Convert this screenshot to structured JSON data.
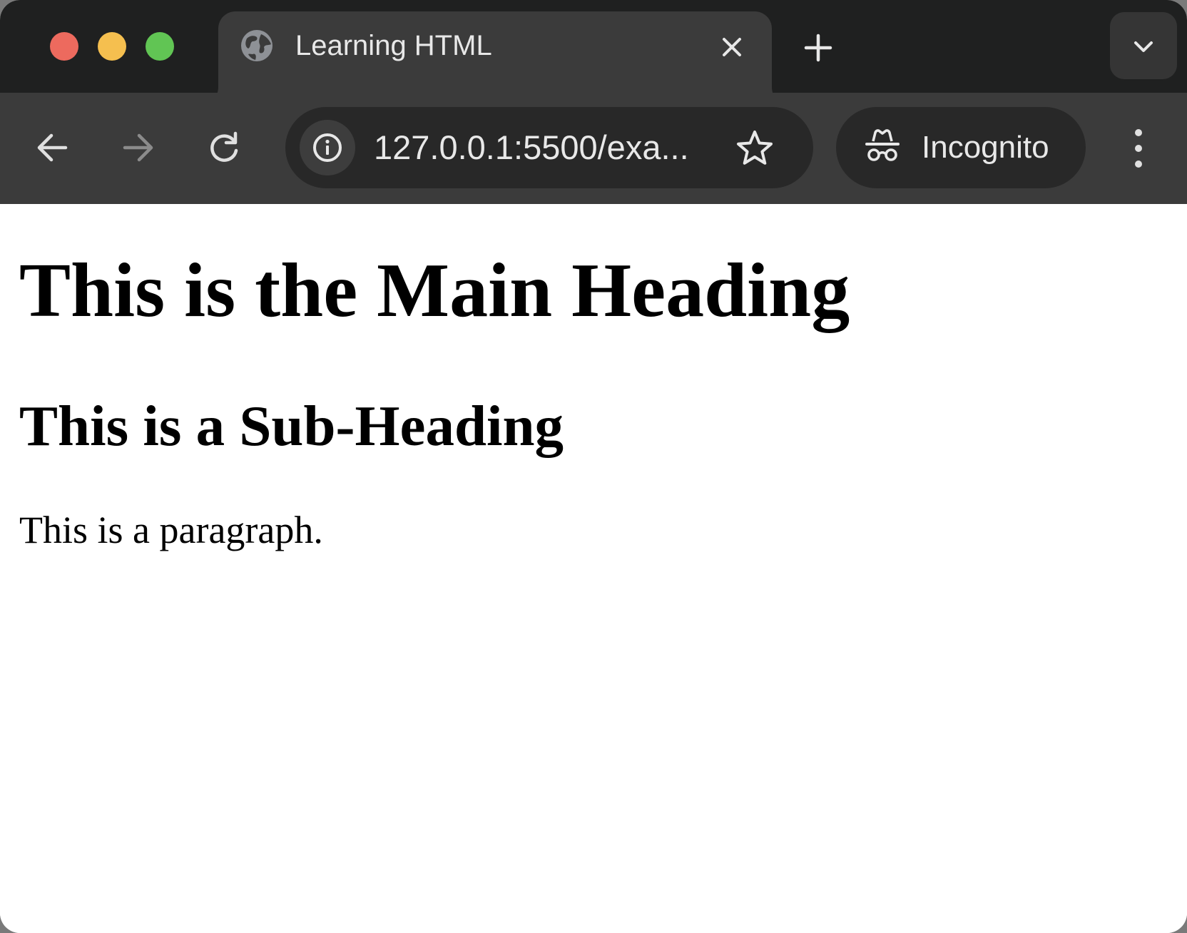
{
  "window": {
    "traffic_lights": [
      "close",
      "minimize",
      "zoom"
    ]
  },
  "tab": {
    "title": "Learning HTML",
    "favicon": "globe-icon"
  },
  "toolbar": {
    "url": "127.0.0.1:5500/exa...",
    "profile_label": "Incognito",
    "icons": [
      "back-arrow-icon",
      "forward-arrow-icon",
      "reload-icon",
      "info-icon",
      "star-icon",
      "incognito-icon",
      "kebab-menu-icon"
    ]
  },
  "page": {
    "heading": "This is the Main Heading",
    "subheading": "This is a Sub-Heading",
    "paragraph": "This is a paragraph."
  },
  "colors": {
    "tabstrip": "#1f2020",
    "toolbar": "#3b3b3b",
    "omnibox": "#282828",
    "close": "#ed6a5e",
    "minimize": "#f5bf4f",
    "zoom": "#61c554"
  }
}
